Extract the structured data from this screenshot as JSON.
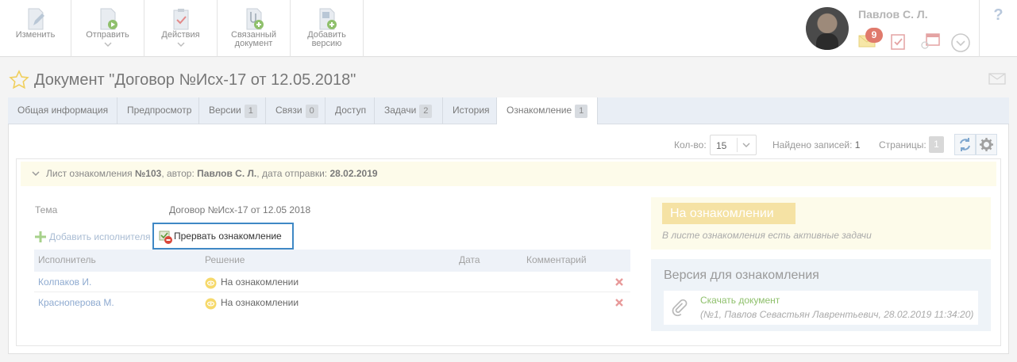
{
  "toolbar": {
    "buttons": [
      {
        "label": "Изменить",
        "label2": "",
        "has_menu": false
      },
      {
        "label": "Отправить",
        "label2": "",
        "has_menu": true
      },
      {
        "label": "Действия",
        "label2": "",
        "has_menu": true
      },
      {
        "label": "Связанный",
        "label2": "документ",
        "has_menu": false
      },
      {
        "label": "Добавить",
        "label2": "версию",
        "has_menu": false
      }
    ]
  },
  "user": {
    "name": "Павлов С. Л.",
    "notifications_count": "9",
    "icons": [
      "envelope-icon",
      "task-check-icon",
      "calendar-icon",
      "dropdown-circle-icon"
    ]
  },
  "help": {
    "label": "?"
  },
  "document": {
    "title": "Документ \"Договор №Исх-17 от 12.05.2018\"",
    "favorite_icon": "star-outline-icon"
  },
  "tabs": [
    {
      "label": "Общая информация",
      "count": ""
    },
    {
      "label": "Предпросмотр",
      "count": ""
    },
    {
      "label": "Версии",
      "count": "1"
    },
    {
      "label": "Связи",
      "count": "0"
    },
    {
      "label": "Доступ",
      "count": ""
    },
    {
      "label": "Задачи",
      "count": "2"
    },
    {
      "label": "История",
      "count": ""
    },
    {
      "label": "Ознакомление",
      "count": "1",
      "active": true
    }
  ],
  "list_controls": {
    "count_label": "Кол-во:",
    "count_value": "15",
    "found_label": "Найдено записей:",
    "found_value": "1",
    "pages_label": "Страницы:",
    "pages_value": "1"
  },
  "sheet": {
    "prefix": "Лист ознакомления",
    "number": "№103",
    "author_label": ", автор:",
    "author": "Павлов С. Л.",
    "date_label": ", дата отправки:",
    "date": "28.02.2019",
    "subject_label": "Тема",
    "subject_value": "Договор №Исх-17 от 12.05 2018",
    "add_executor": "Добавить исполнителя",
    "interrupt": "Прервать ознакомление",
    "columns": {
      "executor": "Исполнитель",
      "decision": "Решение",
      "date": "Дата",
      "comment": "Комментарий"
    },
    "rows": [
      {
        "executor": "Колпаков И.",
        "decision": "На ознакомлении"
      },
      {
        "executor": "Красноперова М.",
        "decision": "На ознакомлении"
      }
    ],
    "status": "На ознакомлении",
    "status_note": "В листе ознакомления есть активные задачи",
    "version_title": "Версия для ознакомления",
    "download_label": "Скачать документ",
    "download_meta": "(№1, Павлов Севастьян Лаврентьевич, 28.02.2019 11:34:20)"
  },
  "colors": {
    "accent_blue": "#3f88c5",
    "status_yellow": "#f5e2a4",
    "link_green": "#8fc06c",
    "delete_red": "#e89a9a"
  }
}
